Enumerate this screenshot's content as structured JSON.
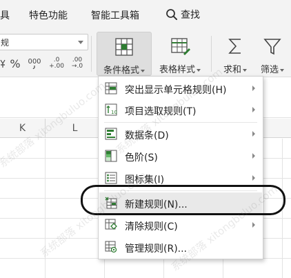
{
  "menubar": {
    "partial_left": "具",
    "tab_special": "特色功能",
    "tab_smart_tools": "智能工具箱",
    "search_label": "查找"
  },
  "ribbon": {
    "number_format_value": "规",
    "percent_label": "%",
    "comma_label": "000",
    "increase_decimal_top": ".0",
    "increase_decimal_bottom": "+.00",
    "decrease_decimal_top": ".00",
    "decrease_decimal_bottom": "→.0",
    "conditional_format_label": "条件格式",
    "table_style_label": "表格样式",
    "sum_label": "求和",
    "filter_label": "筛选"
  },
  "sheet": {
    "columns": [
      "K",
      "L"
    ]
  },
  "dropdown": {
    "items": [
      {
        "label": "突出显示单元格规则(H)",
        "icon": "highlight-rules-icon",
        "submenu": true
      },
      {
        "label": "项目选取规则(T)",
        "icon": "top-bottom-rules-icon",
        "submenu": true
      },
      {
        "label": "数据条(D)",
        "icon": "data-bars-icon",
        "submenu": true
      },
      {
        "label": "色阶(S)",
        "icon": "color-scales-icon",
        "submenu": true
      },
      {
        "label": "图标集(I)",
        "icon": "icon-sets-icon",
        "submenu": true
      },
      {
        "label": "新建规则(N)...",
        "icon": "new-rule-icon",
        "submenu": false
      },
      {
        "label": "清除规则(C)",
        "icon": "clear-rules-icon",
        "submenu": true
      },
      {
        "label": "管理规则(R)...",
        "icon": "manage-rules-icon",
        "submenu": false
      }
    ]
  },
  "watermark": {
    "text": "系统部落 xitongbuluo.com"
  },
  "colors": {
    "accent_green": "#2e7d32",
    "ribbon_bg": "#f3f3f3",
    "highlight_bg": "#e9e9e9",
    "oval_stroke": "#111111"
  }
}
